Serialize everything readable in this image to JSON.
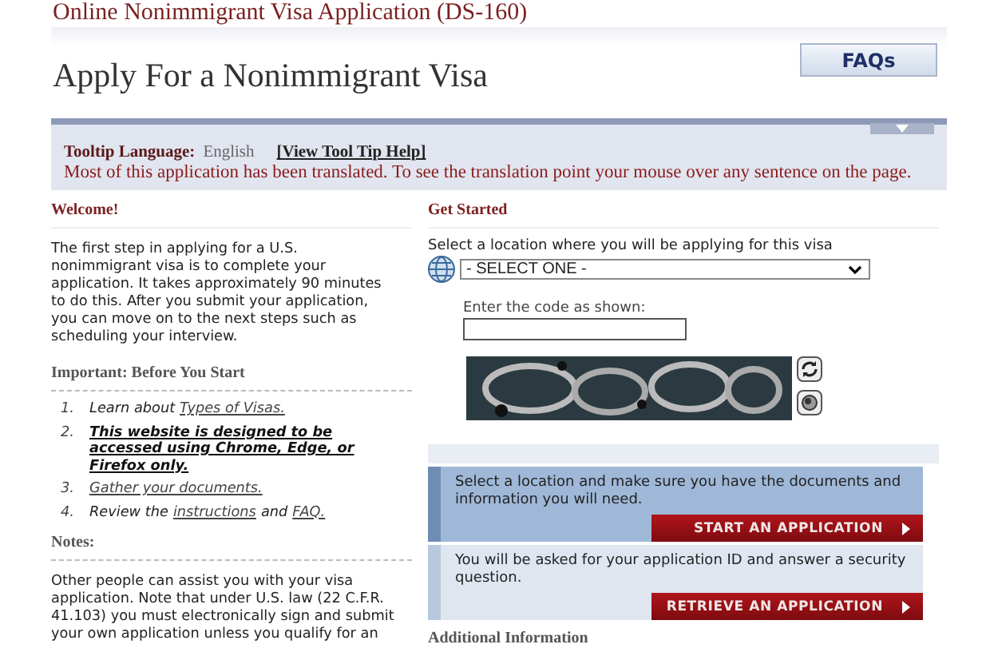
{
  "header": {
    "site_title": "Online Nonimmigrant Visa Application (DS-160)",
    "page_title": "Apply For a Nonimmigrant Visa",
    "faq_button": "FAQs"
  },
  "tooltip_bar": {
    "label": "Tooltip Language:",
    "language": "English",
    "help_link": "[View Tool Tip Help]",
    "message": "Most of this application has been translated. To see the translation point your mouse over any sentence on the page."
  },
  "welcome": {
    "heading": "Welcome!",
    "text": "The first step in applying for a U.S. nonimmigrant visa is to complete your application. It takes approximately 90 minutes to do this. After you submit your application, you can move on to the next steps such as scheduling your interview."
  },
  "important": {
    "heading": "Important: Before You Start",
    "items": [
      {
        "number": "1.",
        "parts": [
          {
            "kind": "text",
            "text": "Learn about"
          },
          {
            "kind": "link",
            "text": "Types of Visas."
          }
        ]
      },
      {
        "number": "2.",
        "parts": [
          {
            "kind": "notice",
            "text": "This website is designed to be accessed using Chrome, Edge, or Firefox only."
          }
        ]
      },
      {
        "number": "3.",
        "parts": [
          {
            "kind": "link",
            "text": "Gather your documents."
          }
        ]
      },
      {
        "number": "4.",
        "parts": [
          {
            "kind": "text",
            "text": "Review the"
          },
          {
            "kind": "link",
            "text": "instructions"
          },
          {
            "kind": "text",
            "text": "and"
          },
          {
            "kind": "link",
            "text": "FAQ."
          }
        ]
      }
    ]
  },
  "notes": {
    "heading": "Notes:",
    "text": "Other people can assist you with your visa application. Note that under U.S. law (22 C.F.R. 41.103) you must electronically sign and submit your own application unless you qualify for an"
  },
  "get_started": {
    "heading": "Get Started",
    "location_label": "Select a location where you will be applying for this visa",
    "location_select": "- SELECT ONE -",
    "code_label": "Enter the code as shown:"
  },
  "actions": [
    {
      "text": "Select a location and make sure you have the documents and information you will need.",
      "button": "START AN APPLICATION",
      "highlighted": true
    },
    {
      "text": "You will be asked for your application ID and answer a security question.",
      "button": "RETRIEVE AN APPLICATION",
      "highlighted": false
    }
  ],
  "additional_heading": "Additional Information"
}
